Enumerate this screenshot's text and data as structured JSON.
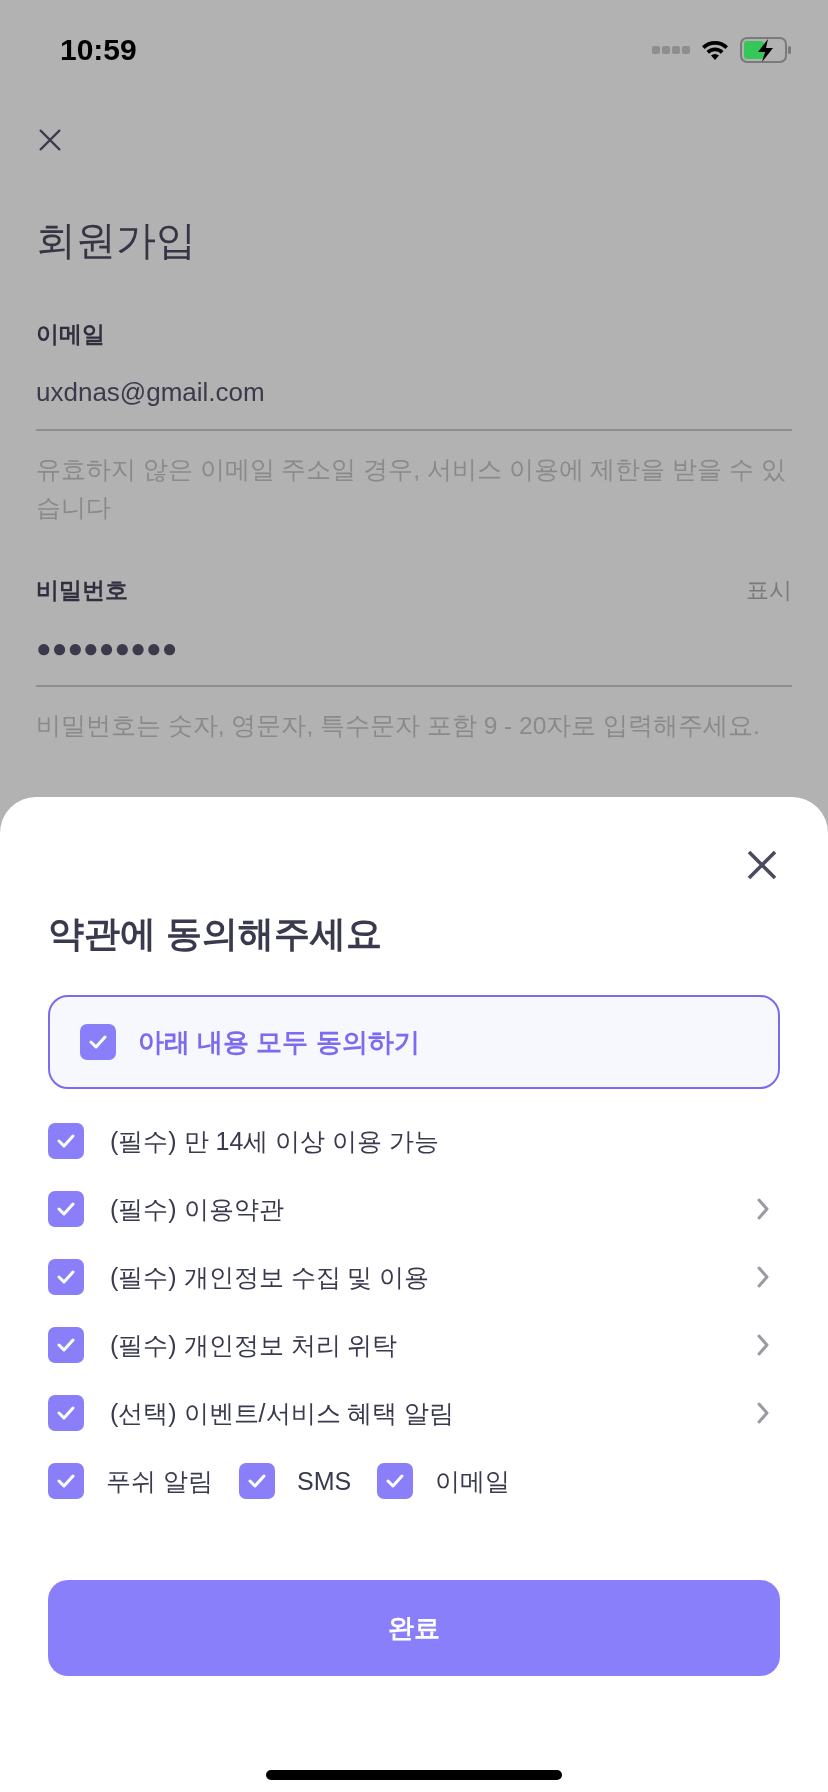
{
  "status_bar": {
    "time": "10:59"
  },
  "page": {
    "title": "회원가입",
    "email": {
      "label": "이메일",
      "value": "uxdnas@gmail.com",
      "hint": "유효하지 않은 이메일 주소일 경우, 서비스 이용에 제한을 받을 수 있습니다"
    },
    "password": {
      "label": "비밀번호",
      "toggle": "표시",
      "value": "●●●●●●●●●",
      "hint": "비밀번호는 숫자, 영문자, 특수문자 포함 9 - 20자로 입력해주세요."
    }
  },
  "sheet": {
    "title": "약관에 동의해주세요",
    "agree_all": {
      "label": "아래 내용 모두 동의하기",
      "checked": true
    },
    "terms": [
      {
        "label": "(필수) 만 14세 이상 이용 가능",
        "checked": true,
        "has_detail": false
      },
      {
        "label": "(필수) 이용약관",
        "checked": true,
        "has_detail": true
      },
      {
        "label": "(필수) 개인정보 수집 및 이용",
        "checked": true,
        "has_detail": true
      },
      {
        "label": "(필수) 개인정보 처리 위탁",
        "checked": true,
        "has_detail": true
      },
      {
        "label": "(선택) 이벤트/서비스 혜택 알림",
        "checked": true,
        "has_detail": true
      }
    ],
    "channels": [
      {
        "label": "푸쉬 알림",
        "checked": true
      },
      {
        "label": "SMS",
        "checked": true
      },
      {
        "label": "이메일",
        "checked": true
      }
    ],
    "submit": {
      "label": "완료"
    }
  }
}
